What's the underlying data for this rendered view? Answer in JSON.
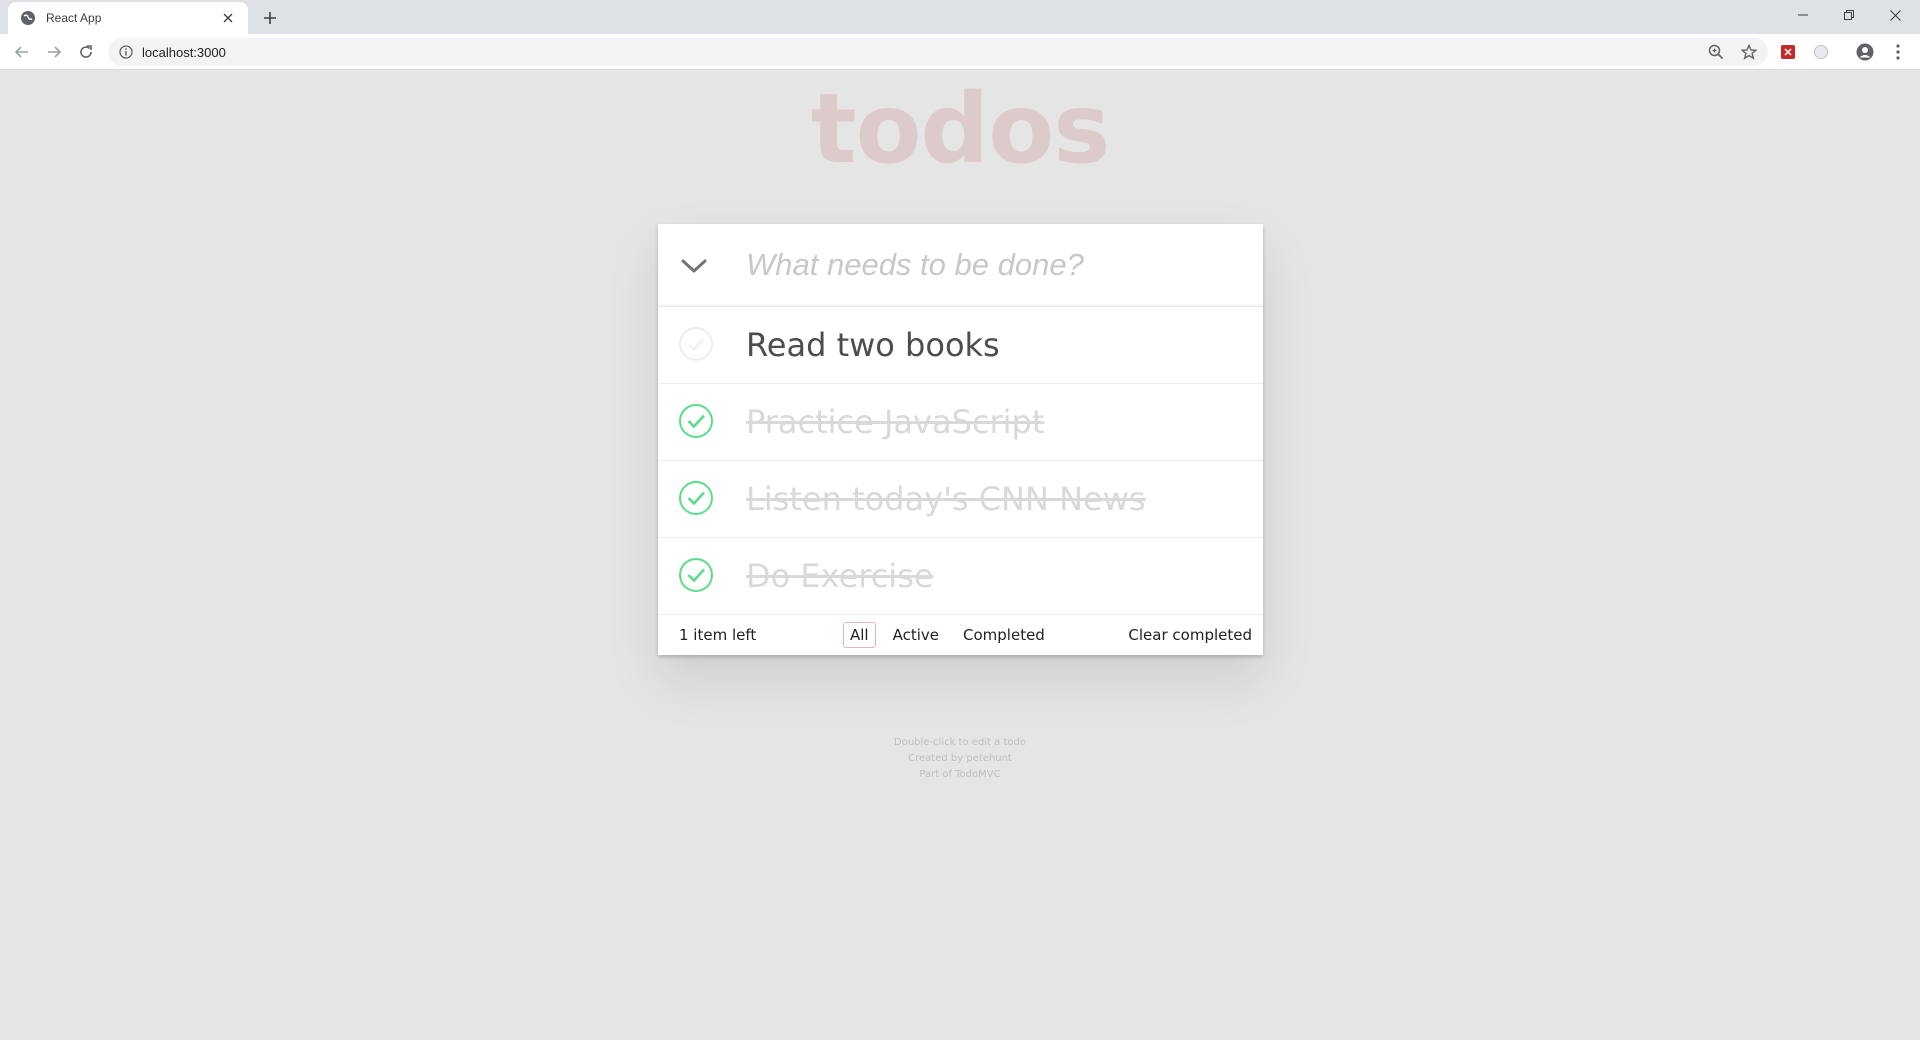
{
  "browser": {
    "tab_title": "React App",
    "url": "localhost:3000"
  },
  "app": {
    "title": "todos",
    "new_todo_placeholder": "What needs to be done?",
    "todos": [
      {
        "text": "Read two books",
        "completed": false
      },
      {
        "text": "Practice JavaScript",
        "completed": true
      },
      {
        "text": "Listen today's CNN News",
        "completed": true
      },
      {
        "text": "Do Exercise",
        "completed": true
      }
    ],
    "footer": {
      "count_text": "1 item left",
      "filters": [
        "All",
        "Active",
        "Completed"
      ],
      "selected_filter": "All",
      "clear_label": "Clear completed"
    },
    "info": {
      "line1": "Double-click to edit a todo",
      "line2": "Created by petehunt",
      "line3": "Part of TodoMVC"
    }
  },
  "colors": {
    "background": "#e5e5e5",
    "title": "rgba(175,47,47,0.15)",
    "check_green": "#5dc2af",
    "check_done": "#59dd8a"
  }
}
